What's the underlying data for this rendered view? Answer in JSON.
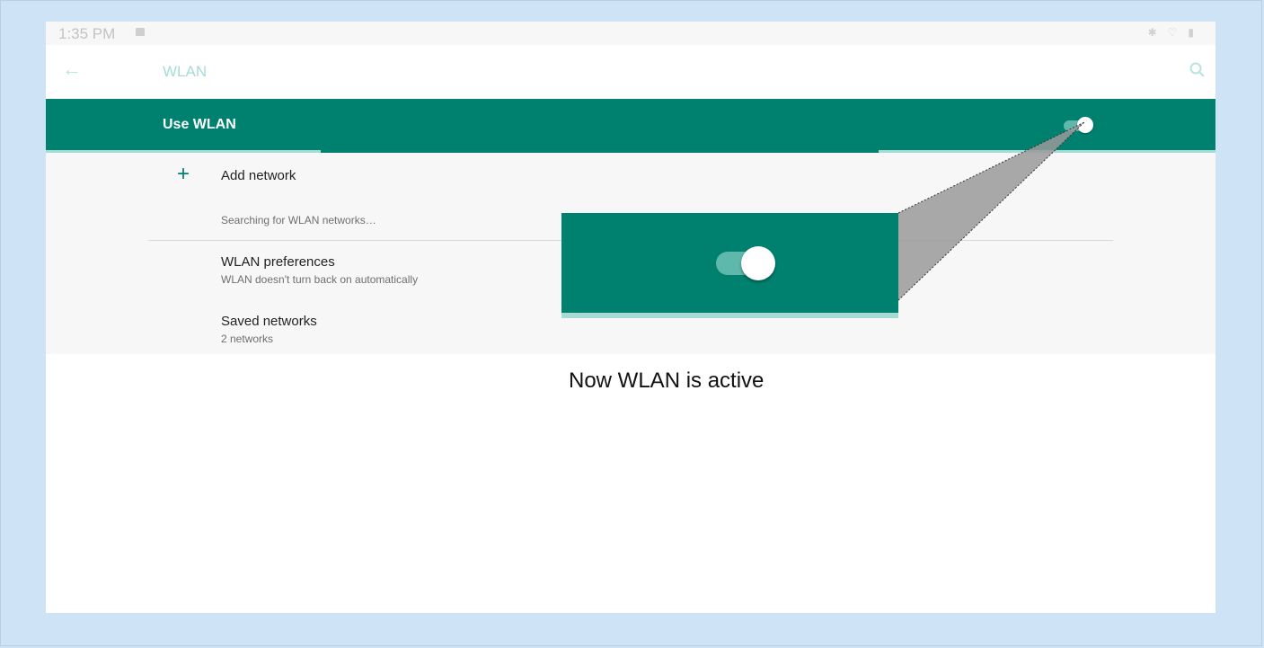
{
  "status_bar": {
    "time": "1:35 PM",
    "icons": [
      "image-icon",
      "bluetooth-icon",
      "wifi-icon",
      "battery-icon"
    ]
  },
  "app_bar": {
    "title": "WLAN",
    "back_icon": "arrow-left-icon",
    "search_icon": "search-icon"
  },
  "master_switch": {
    "label": "Use WLAN",
    "state": "on"
  },
  "list": {
    "add_network": {
      "label": "Add network",
      "icon": "plus-icon"
    },
    "status_text": "Searching for WLAN networks…",
    "items": [
      {
        "title": "WLAN preferences",
        "subtitle": "WLAN doesn't turn back on automatically"
      },
      {
        "title": "Saved networks",
        "subtitle": "2 networks"
      }
    ]
  },
  "callout": {
    "caption": "Now WLAN is active"
  },
  "colors": {
    "accent": "#00806f",
    "accent_light": "#a7dcd5",
    "frame": "#cfe3f7"
  }
}
